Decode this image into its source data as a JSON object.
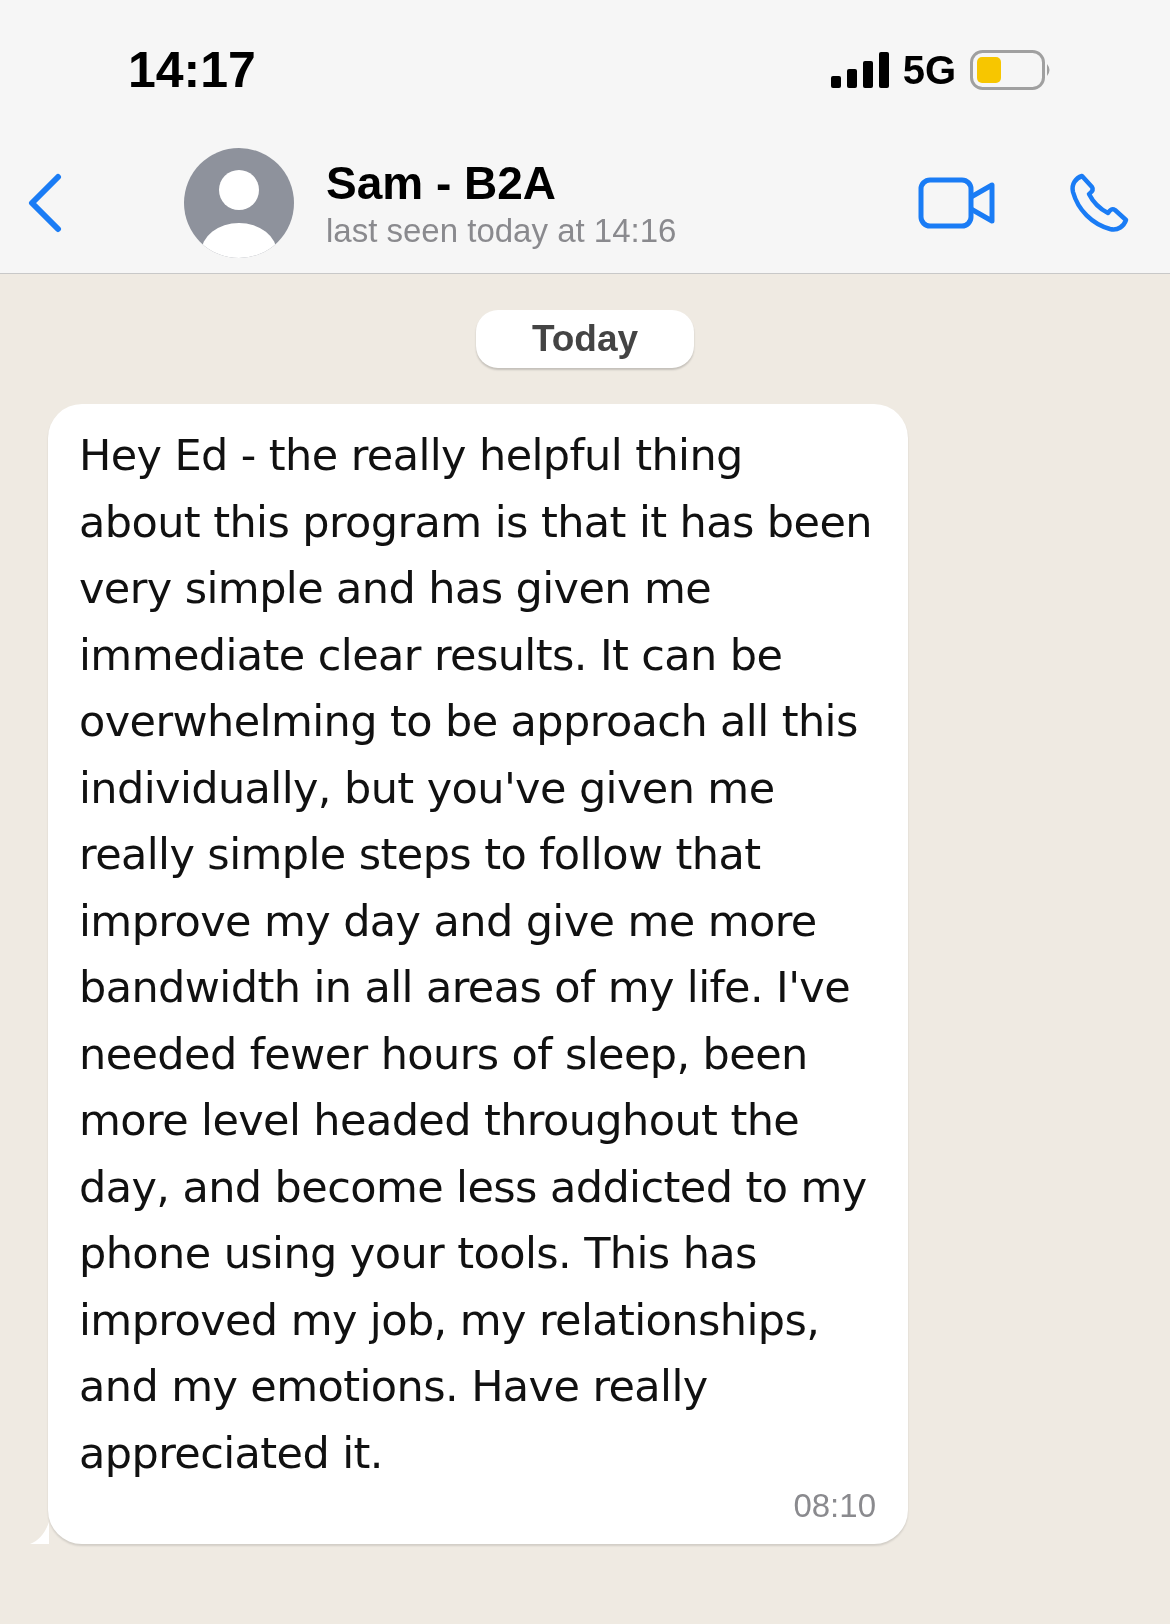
{
  "status_bar": {
    "time": "14:17",
    "network": "5G"
  },
  "header": {
    "contact_name": "Sam - B2A",
    "last_seen": "last seen today at 14:16"
  },
  "date_label": "Today",
  "messages": [
    {
      "kind": "incoming",
      "text": "Hey Ed - the really helpful thing about this program is that it has been very simple and has given me immediate clear results. It can be overwhelming to be approach all this individually, but you've given me really simple steps to follow that improve my day and give me more bandwidth in all areas of my life. I've needed fewer hours of sleep, been more level headed throughout the day, and become less addicted to my phone using your tools. This has improved my job, my relationships, and my emotions. Have really appreciated it.",
      "time": "08:10"
    }
  ]
}
